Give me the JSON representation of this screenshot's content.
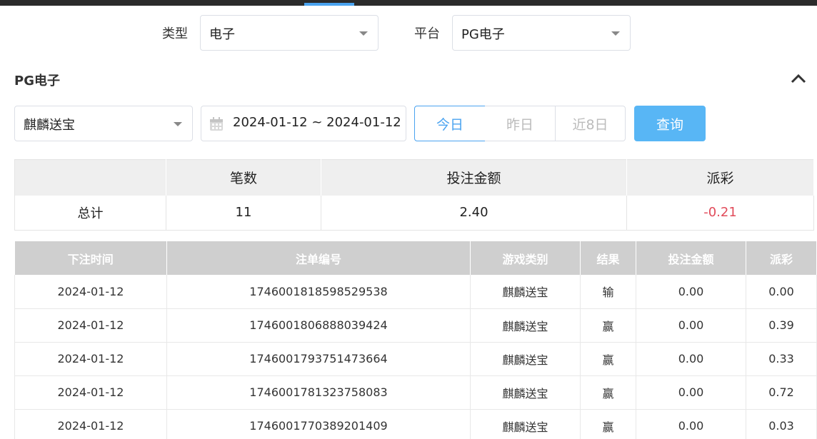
{
  "filters": {
    "type_label": "类型",
    "type_value": "电子",
    "platform_label": "平台",
    "platform_value": "PG电子"
  },
  "section": {
    "title": "PG电子"
  },
  "search": {
    "game_value": "麒麟送宝",
    "date_range": "2024-01-12 ~ 2024-01-12",
    "quick_today": "今日",
    "quick_yesterday": "昨日",
    "quick_8days": "近8日",
    "query_button": "查询"
  },
  "summary": {
    "headers": [
      "",
      "笔数",
      "投注金额",
      "派彩"
    ],
    "row": {
      "label": "总计",
      "count": "11",
      "bet_amount": "2.40",
      "payout": "-0.21"
    }
  },
  "detail": {
    "headers": [
      "下注时间",
      "注单编号",
      "游戏类别",
      "结果",
      "投注金额",
      "派彩"
    ],
    "rows": [
      [
        "2024-01-12",
        "1746001818598529538",
        "麒麟送宝",
        "输",
        "0.00",
        "0.00"
      ],
      [
        "2024-01-12",
        "1746001806888039424",
        "麒麟送宝",
        "赢",
        "0.00",
        "0.39"
      ],
      [
        "2024-01-12",
        "1746001793751473664",
        "麒麟送宝",
        "赢",
        "0.00",
        "0.33"
      ],
      [
        "2024-01-12",
        "1746001781323758083",
        "麒麟送宝",
        "赢",
        "0.00",
        "0.72"
      ],
      [
        "2024-01-12",
        "1746001770389201409",
        "麒麟送宝",
        "赢",
        "0.00",
        "0.03"
      ]
    ]
  },
  "colors": {
    "accent": "#4aa3f0",
    "query_button": "#58b6f5",
    "negative": "#e14b5a"
  }
}
